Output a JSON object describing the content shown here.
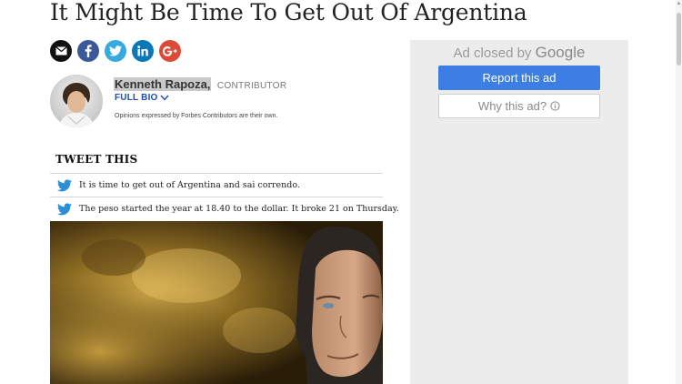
{
  "article": {
    "headline": "It Might Be Time To Get Out Of Argentina"
  },
  "share": {
    "buttons": [
      {
        "name": "email",
        "icon": "email-icon",
        "color": "#111111"
      },
      {
        "name": "facebook",
        "icon": "facebook-icon",
        "color": "#3b5998"
      },
      {
        "name": "twitter",
        "icon": "twitter-icon",
        "color": "#36a9e0"
      },
      {
        "name": "linkedin",
        "icon": "linkedin-icon",
        "color": "#0b78b5"
      },
      {
        "name": "google-plus",
        "icon": "google-plus-icon",
        "color": "#dc4a38"
      }
    ]
  },
  "author": {
    "name": "Kenneth Rapoza,",
    "role": "CONTRIBUTOR",
    "full_bio": "FULL BIO",
    "disclaimer": "Opinions expressed by Forbes Contributors are their own."
  },
  "tweet_this": {
    "heading": "TWEET THIS",
    "items": [
      "It is time to get out of Argentina and sai correndo.",
      "The peso started the year at 18.40 to the dollar. It broke 21 on Thursday."
    ]
  },
  "ad": {
    "closed_prefix": "Ad closed by",
    "closed_brand": "Google",
    "report_label": "Report this ad",
    "why_label": "Why this ad?",
    "accent": "#3d7ee4"
  }
}
